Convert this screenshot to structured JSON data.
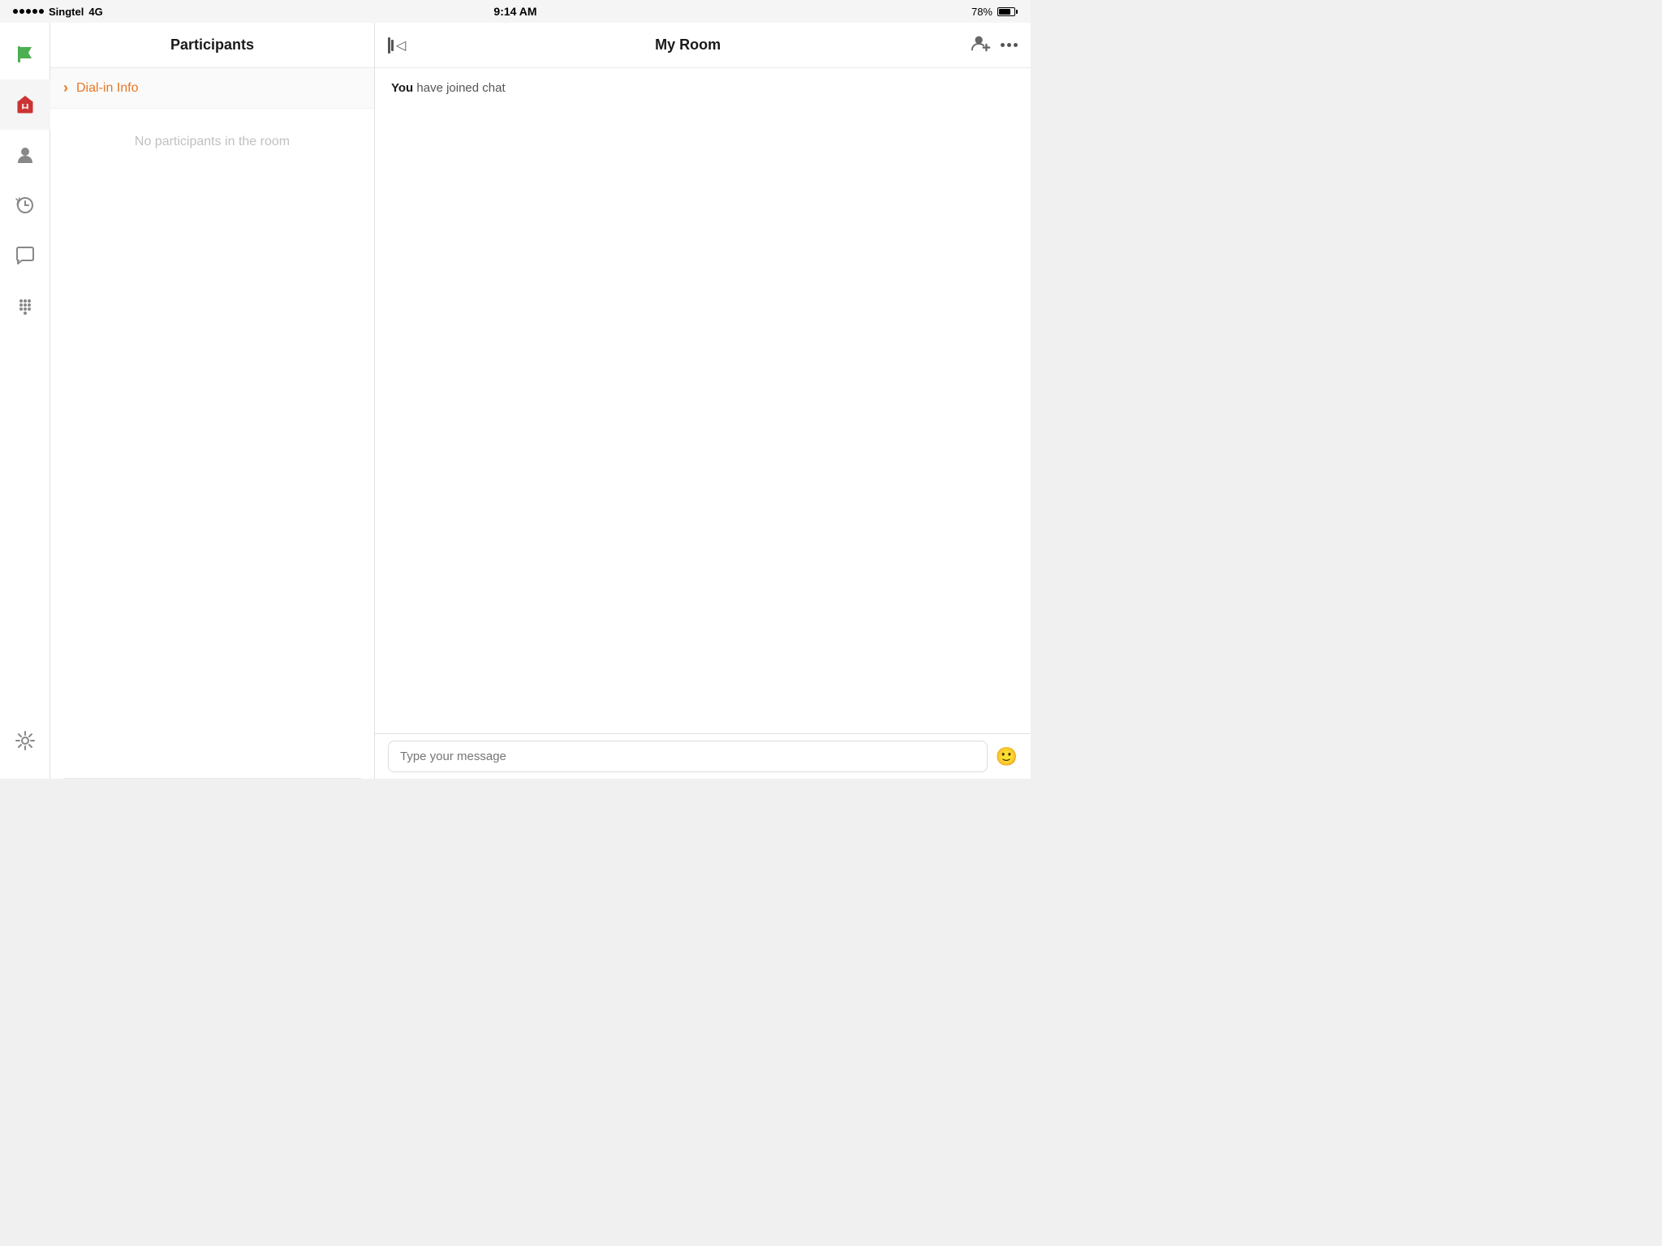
{
  "statusBar": {
    "carrier": "Singtel",
    "network": "4G",
    "time": "9:14 AM",
    "battery": "78%",
    "signalDots": 5
  },
  "sidebar": {
    "items": [
      {
        "name": "flag-icon",
        "label": "Flag",
        "active": false
      },
      {
        "name": "home-icon",
        "label": "Home",
        "active": true
      },
      {
        "name": "person-icon",
        "label": "Person",
        "active": false
      },
      {
        "name": "history-icon",
        "label": "History",
        "active": false
      },
      {
        "name": "chat-icon",
        "label": "Chat",
        "active": false
      },
      {
        "name": "dialpad-icon",
        "label": "Dialpad",
        "active": false
      }
    ],
    "bottomItems": [
      {
        "name": "settings-icon",
        "label": "Settings",
        "active": false
      }
    ]
  },
  "participants": {
    "title": "Participants",
    "dialInLabel": "Dial-in Info",
    "noParticipantsText": "No participants in the room"
  },
  "chat": {
    "title": "My Room",
    "collapseAriaLabel": "Collapse panel",
    "addParticipantAriaLabel": "Add participant",
    "moreOptionsAriaLabel": "More options",
    "systemMessage": {
      "bold": "You",
      "rest": " have joined chat"
    },
    "inputPlaceholder": "Type your message"
  }
}
